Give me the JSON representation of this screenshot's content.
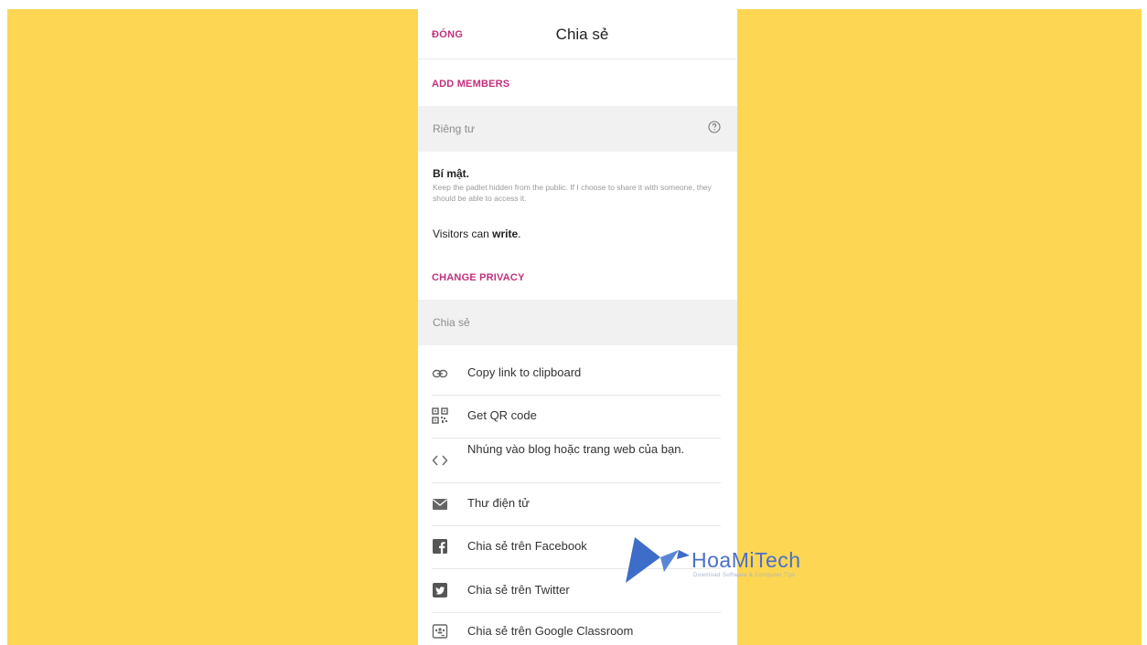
{
  "header": {
    "close_label": "ĐÓNG",
    "title": "Chia sẻ"
  },
  "members": {
    "add_label": "ADD MEMBERS"
  },
  "privacy": {
    "section_label": "Riêng tư",
    "name": "Bí mật.",
    "description": "Keep the padlet hidden from the public. If I choose to share it with someone, they should be able to access it.",
    "visitors_prefix": "Visitors can ",
    "visitors_permission": "write",
    "visitors_suffix": ".",
    "change_label": "CHANGE PRIVACY"
  },
  "share": {
    "section_label": "Chia sẻ",
    "items": [
      {
        "label": "Copy link to clipboard",
        "icon": "link-icon"
      },
      {
        "label": "Get QR code",
        "icon": "qr-code-icon"
      },
      {
        "label": "Nhúng vào blog hoặc trang web của bạn.",
        "icon": "embed-code-icon"
      },
      {
        "label": "Thư điện tử",
        "icon": "envelope-icon"
      },
      {
        "label": "Chia sẻ trên Facebook",
        "icon": "facebook-icon"
      },
      {
        "label": "Chia sẻ trên Twitter",
        "icon": "twitter-icon"
      },
      {
        "label": "Chia sẻ trên Google Classroom",
        "icon": "google-classroom-icon"
      }
    ]
  },
  "watermark": {
    "name": "HoaMiTech",
    "tagline": "Download Software & Computer Tips"
  },
  "colors": {
    "background": "#FDD753",
    "accent": "#C2307E",
    "section_band": "#F1F1F1",
    "watermark": "#4A6FC8"
  }
}
